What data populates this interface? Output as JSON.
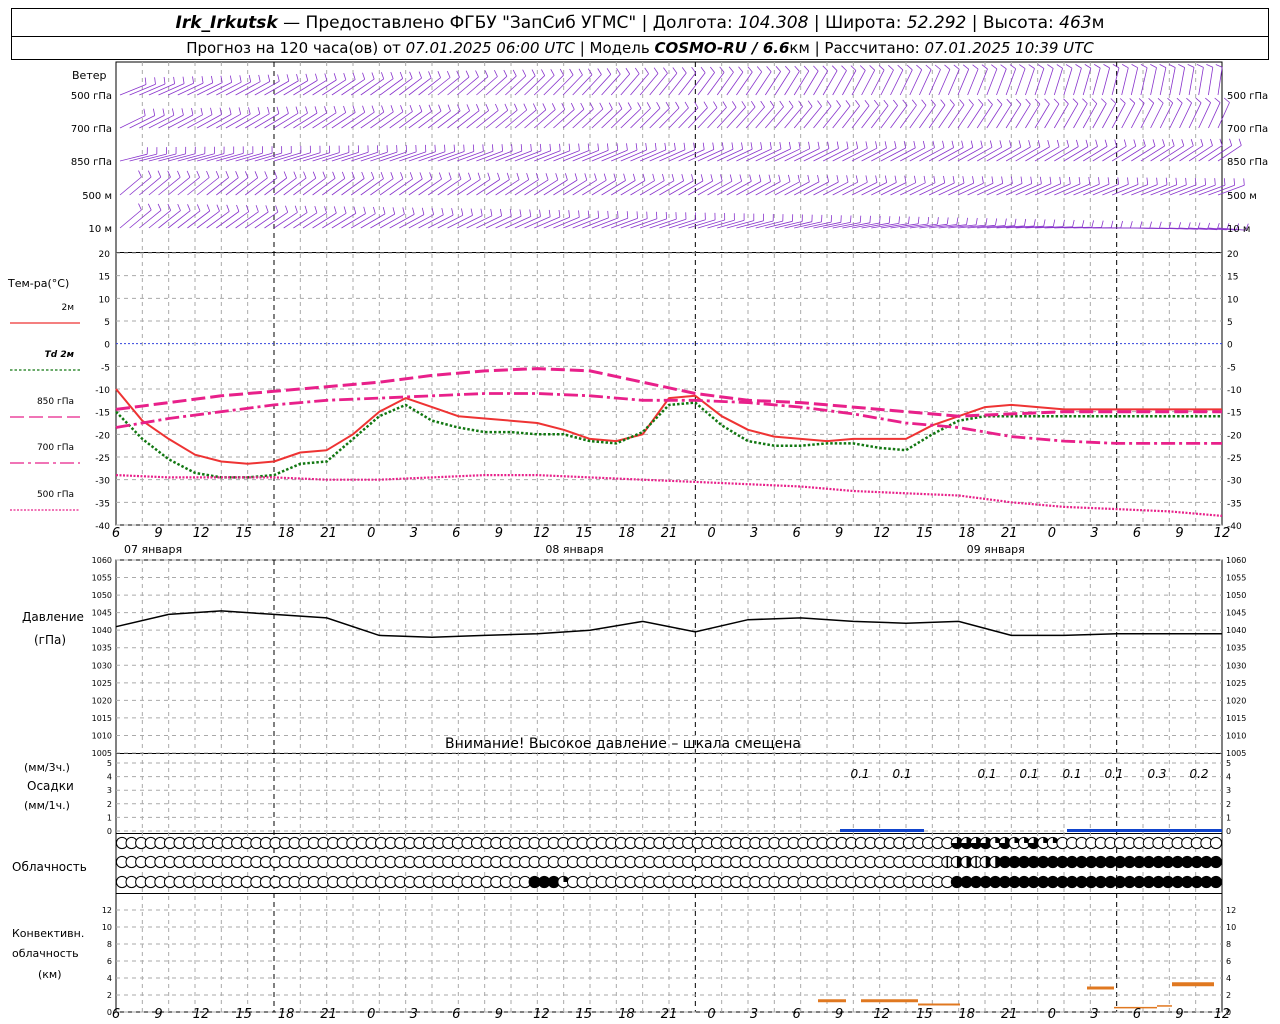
{
  "header": {
    "station": "Irk_Irkutsk",
    "provider": "— Предоставлено ФГБУ \"ЗапСиб УГМС\"",
    "lon_label": "| Долгота:",
    "lon": "104.308",
    "lat_label": "| Широта:",
    "lat": "52.292",
    "alt_label": "| Высота:",
    "alt": "463",
    "alt_unit": "м",
    "forecast_label": "Прогноз на 120 часа(ов) от",
    "forecast_time": "07.01.2025 06:00 UTC",
    "model_label": "| Модель",
    "model": "COSMO-RU / 6.6",
    "model_unit": "км",
    "computed_label": "| Рассчитано:",
    "computed_time": "07.01.2025 10:39 UTC"
  },
  "panels": {
    "wind": {
      "title": "Ветер",
      "levels": [
        "500 гПа",
        "700 гПа",
        "850 гПа",
        "500 м",
        "10 м"
      ]
    },
    "temp": {
      "title": "Тем-ра(°С)"
    },
    "pressure": {
      "title": "Давление",
      "unit": "(гПа)",
      "warning": "Внимание! Высокое давление – шкала смещена"
    },
    "precip": {
      "unit1": "(мм/3ч.)",
      "title": "Осадки",
      "unit2": "(мм/1ч.)"
    },
    "cloud": {
      "title": "Облачность"
    },
    "conv": {
      "title1": "Конвективн.",
      "title2": "облачность",
      "unit": "(км)"
    }
  },
  "time_axis": {
    "hour_labels": [
      "6",
      "9",
      "12",
      "15",
      "18",
      "21",
      "0",
      "3",
      "6",
      "9",
      "12",
      "15",
      "18",
      "21",
      "0",
      "3",
      "6",
      "9",
      "12",
      "15",
      "18",
      "21",
      "0",
      "3",
      "6",
      "9",
      "12"
    ],
    "day_labels": [
      "07 января",
      "08 января",
      "09 января"
    ]
  },
  "colors": {
    "t2m": "#ee3333",
    "td2m": "#117711",
    "t850": "#e8208a",
    "t700": "#e8208a",
    "t500": "#e8208a",
    "pressure": "#000000",
    "wind": "#8833cc",
    "precip": "#1144cc",
    "conv": "#e07820",
    "zero_line": "#3344dd"
  },
  "chart_data": [
    {
      "type": "line",
      "title": "Тем-ра(°С)",
      "ylim": [
        -40,
        20
      ],
      "y_ticks": [
        20,
        15,
        10,
        5,
        0,
        -5,
        -10,
        -15,
        -20,
        -25,
        -30,
        -35,
        -40
      ],
      "x_unit": "hours from 07.01 06 UTC",
      "series": [
        {
          "name": "2м",
          "style": "solid",
          "x": [
            0,
            3,
            6,
            9,
            12,
            15,
            18,
            21,
            24,
            27,
            30,
            33,
            36,
            39,
            42,
            45,
            48,
            51,
            54,
            57,
            60,
            63,
            66,
            69,
            72,
            75,
            78,
            81,
            84,
            87,
            90,
            93,
            96,
            99,
            102,
            105,
            108,
            111,
            114,
            117,
            120,
            123,
            126
          ],
          "y": [
            -10,
            -17,
            -21,
            -24.5,
            -26,
            -26.5,
            -26,
            -24,
            -23.5,
            -20,
            -15,
            -12,
            -14,
            -16,
            -16.5,
            -17,
            -17.5,
            -19,
            -21,
            -21.5,
            -20,
            -12,
            -11.5,
            -16,
            -19,
            -20.5,
            -21,
            -21.5,
            -21,
            -21,
            -21,
            -18,
            -16,
            -14,
            -13.5,
            -14,
            -14.5,
            -14.5,
            -14.5,
            -14.5,
            -14.5,
            -14.5,
            -14.5
          ]
        },
        {
          "name": "Td 2м",
          "style": "dotted",
          "x": [
            0,
            3,
            6,
            9,
            12,
            15,
            18,
            21,
            24,
            27,
            30,
            33,
            36,
            39,
            42,
            45,
            48,
            51,
            54,
            57,
            60,
            63,
            66,
            69,
            72,
            75,
            78,
            81,
            84,
            87,
            90,
            93,
            96,
            99,
            102,
            105,
            108,
            111,
            114,
            117,
            120,
            123,
            126
          ],
          "y": [
            -15,
            -21,
            -25.5,
            -28.5,
            -29.5,
            -29.5,
            -29,
            -26.5,
            -26,
            -21,
            -16,
            -13.5,
            -17,
            -18.5,
            -19.5,
            -19.5,
            -20,
            -20,
            -21.5,
            -22,
            -19.5,
            -13.5,
            -13,
            -18,
            -21.5,
            -22.5,
            -22.5,
            -22,
            -22,
            -23,
            -23.5,
            -20,
            -17,
            -16,
            -16,
            -16,
            -16,
            -16,
            -16,
            -16,
            -16,
            -16,
            -16
          ]
        },
        {
          "name": "850 гПа",
          "style": "dashed",
          "x": [
            0,
            6,
            12,
            18,
            24,
            30,
            36,
            42,
            48,
            54,
            60,
            66,
            72,
            78,
            84,
            90,
            96,
            102,
            108,
            114,
            120,
            126
          ],
          "y": [
            -14.5,
            -13,
            -11.5,
            -10.5,
            -9.5,
            -8.5,
            -7,
            -6,
            -5.5,
            -6,
            -8.5,
            -11,
            -12.5,
            -13,
            -14,
            -15,
            -16,
            -15.5,
            -15,
            -15,
            -15,
            -15
          ]
        },
        {
          "name": "700 гПа",
          "style": "dashdot",
          "x": [
            0,
            6,
            12,
            18,
            24,
            30,
            36,
            42,
            48,
            54,
            60,
            66,
            72,
            78,
            84,
            90,
            96,
            102,
            108,
            114,
            120,
            126
          ],
          "y": [
            -18.5,
            -16.5,
            -15,
            -13.5,
            -12.5,
            -12,
            -11.5,
            -11,
            -11,
            -11.5,
            -12.5,
            -12.5,
            -13,
            -14,
            -15.5,
            -17.5,
            -18.5,
            -20.5,
            -21.5,
            -22,
            -22,
            -22
          ]
        },
        {
          "name": "500 гПа",
          "style": "dotted-fine",
          "x": [
            0,
            6,
            12,
            18,
            24,
            30,
            36,
            42,
            48,
            54,
            60,
            66,
            72,
            78,
            84,
            90,
            96,
            102,
            108,
            114,
            120,
            126
          ],
          "y": [
            -29,
            -29.5,
            -29.5,
            -29.5,
            -30,
            -30,
            -29.5,
            -29,
            -29,
            -29.5,
            -30,
            -30.5,
            -31,
            -31.5,
            -32.5,
            -33,
            -33.5,
            -35,
            -36,
            -36.5,
            -37,
            -38
          ]
        }
      ]
    },
    {
      "type": "line",
      "title": "Давление",
      "ylim": [
        1005,
        1060
      ],
      "y_ticks": [
        1060,
        1055,
        1050,
        1045,
        1040,
        1035,
        1030,
        1025,
        1020,
        1015,
        1010,
        1005
      ],
      "series": [
        {
          "name": "Давление",
          "x": [
            0,
            6,
            12,
            18,
            24,
            30,
            36,
            42,
            48,
            54,
            60,
            66,
            72,
            78,
            84,
            90,
            96,
            102,
            108,
            114,
            120,
            126
          ],
          "y": [
            1041,
            1044.5,
            1045.5,
            1044.5,
            1043.5,
            1038.5,
            1038,
            1038.5,
            1039,
            1040,
            1042.5,
            1039.5,
            1043,
            1043.5,
            1042.5,
            1042,
            1042.5,
            1038.5,
            1038.5,
            1039,
            1039,
            1039
          ]
        }
      ]
    },
    {
      "type": "bar",
      "title": "Осадки",
      "ylim": [
        0,
        5
      ],
      "y_ticks": [
        5,
        4,
        3,
        2,
        1,
        0
      ],
      "value_labels": [
        "0.1",
        "0.1",
        "0.1",
        "0.1",
        "0.1",
        "0.1",
        "0.3",
        "0.2"
      ]
    },
    {
      "type": "bar",
      "title": "Конвективн. облачность",
      "ylim": [
        0,
        14
      ],
      "y_ticks": [
        12,
        10,
        8,
        6,
        4,
        2,
        0
      ]
    }
  ],
  "cloud_rows": [
    "ooooooooooooooooooooooooooooooooooooooooooooooooooooooooooooooooooooooooooooooooooooooo3333q3qq3qqooooooooooooooooooo",
    "oooooooooooooooooooooooooooooooooooooooooooooooooooooooooooooooooooooooooooooooooooooo1hh1hh2222222222222222222222222",
    "ooooooooooooooooooooooooooooooooooooooooooo222qoooooooooooooooooooooooooooooooooooooooo222222222222222222222222222222"
  ]
}
